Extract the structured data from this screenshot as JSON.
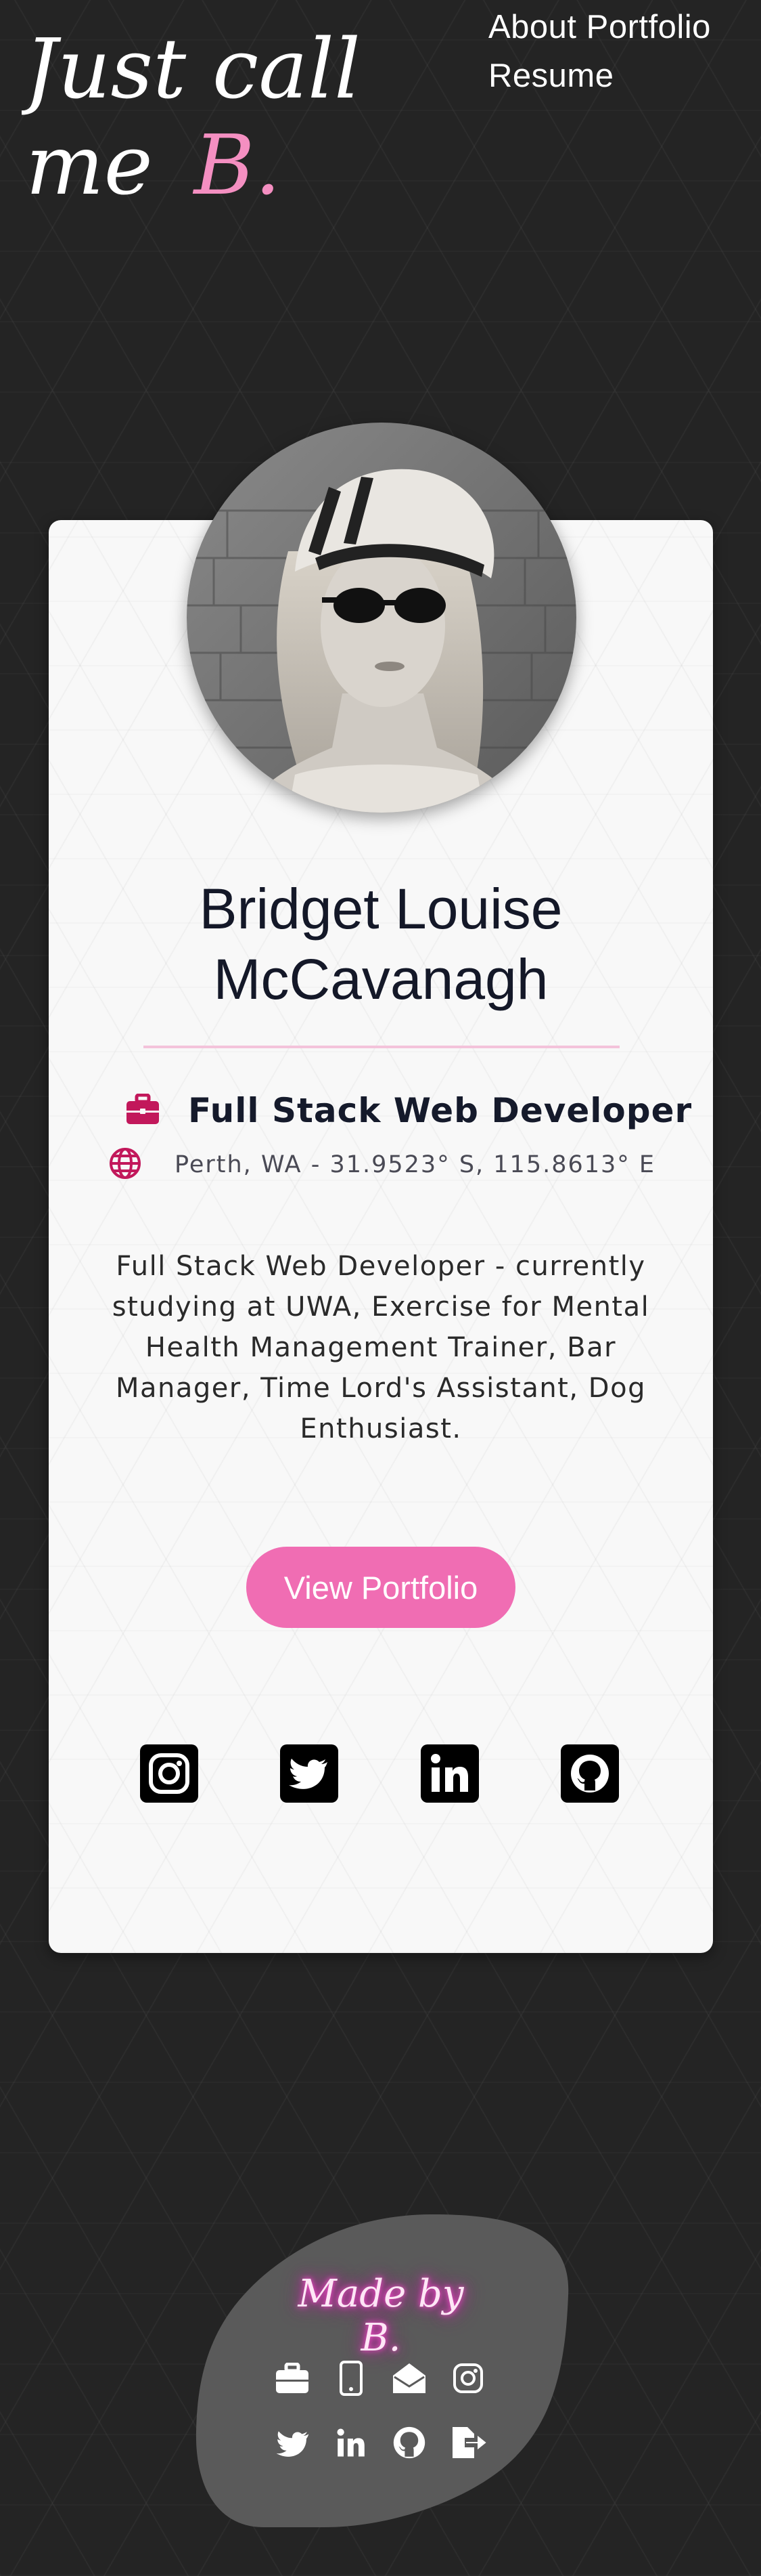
{
  "header": {
    "logo_line1": "Just call",
    "logo_line2_prefix": "me",
    "logo_line2_accent": "B."
  },
  "nav": {
    "items": [
      {
        "label": "About Portfolio"
      },
      {
        "label": "Resume"
      }
    ]
  },
  "profile": {
    "name_line1": "Bridget Louise",
    "name_line2": "McCavanagh",
    "job_title": "Full Stack Web Developer",
    "location": "Perth, WA - 31.9523° S, 115.8613° E",
    "bio": "Full Stack Web Developer - currently studying at UWA, Exercise for Mental Health Management Trainer, Bar Manager, Time Lord's Assistant, Dog Enthusiast.",
    "cta_label": "View Portfolio",
    "social_icons": [
      "instagram-icon",
      "twitter-icon",
      "linkedin-icon",
      "github-icon"
    ]
  },
  "footer": {
    "made_by": "Made by B.",
    "icons_row1": [
      "briefcase-icon",
      "phone-icon",
      "email-icon",
      "instagram-icon"
    ],
    "icons_row2": [
      "twitter-icon",
      "linkedin-icon",
      "github-icon",
      "sign-out-icon"
    ]
  },
  "colors": {
    "background": "#242424",
    "card": "#f8f8f8",
    "accent_pink": "#f06db3",
    "icon_magenta": "#c2185b",
    "footer_blob": "#5a5a5a"
  }
}
